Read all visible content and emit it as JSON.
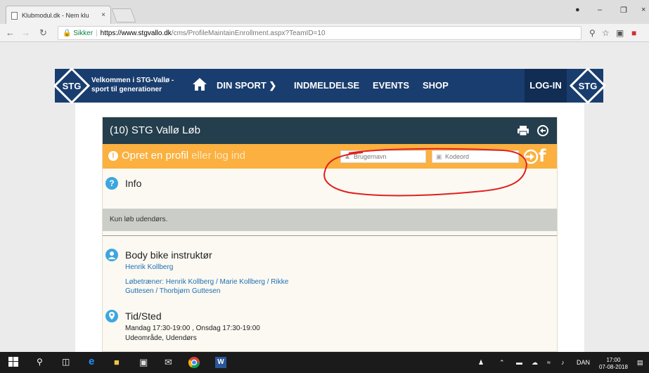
{
  "browser": {
    "tab_title": "Klubmodul.dk - Nem klu",
    "tab_close": "×",
    "secure_label": "Sikker",
    "url_host": "https://www.stgvallo.dk",
    "url_path": "/cms/ProfileMaintainEnrollment.aspx?TeamID=10"
  },
  "site": {
    "welcome_line1": "Velkommen i STG-Vallø -",
    "welcome_line2": "sport til generationer",
    "logo_text": "STG",
    "nav": [
      "DIN SPORT",
      "INDMELDELSE",
      "EVENTS",
      "SHOP"
    ],
    "login_label": "LOG-IN"
  },
  "panel": {
    "title": "(10) STG Vallø Løb",
    "login_prompt_a": "Opret en profil",
    "login_prompt_b": " eller log ind",
    "username_placeholder": "Brugernavn",
    "password_placeholder": "Kodeord",
    "info_title": "Info",
    "info_note": "Kun løb udendørs.",
    "instructor_title": "Body bike instruktør",
    "instructor_name": "Henrik Kollberg",
    "trainers_line1": "Løbetræner: Henrik Kollberg / Marie Kollberg / Rikke",
    "trainers_line2": "Guttesen / Thorbjørn Guttesen",
    "time_title": "Tid/Sted",
    "time_text": "Mandag 17:30-19:00 , Onsdag 17:30-19:00",
    "place_text": "Udeområde, Udendørs"
  },
  "taskbar": {
    "lang": "DAN",
    "time": "17:00",
    "date": "07-08-2018"
  },
  "colors": {
    "nav_blue": "#193d6e",
    "panel_header": "#243e4d",
    "login_bar": "#fbb03f",
    "section_icon": "#3da6e0",
    "annotation_red": "#e0201e"
  }
}
